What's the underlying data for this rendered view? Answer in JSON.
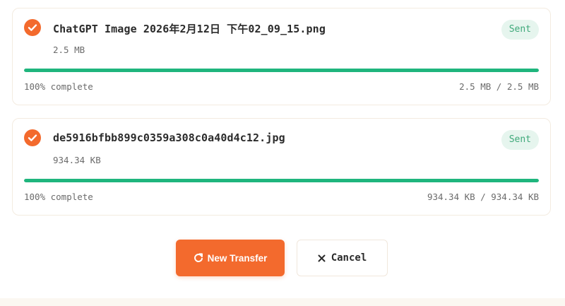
{
  "colors": {
    "accent": "#f36a2d",
    "success": "#1fb57d",
    "badge_bg": "#e6f5ee",
    "badge_text": "#3fa97a"
  },
  "transfers": [
    {
      "icon": "check-circle-icon",
      "file_name": "ChatGPT Image 2026年2月12日 下午02_09_15.png",
      "file_size": "2.5 MB",
      "status": "Sent",
      "progress_percent": 100,
      "progress_label": "100% complete",
      "progress_bytes": "2.5 MB / 2.5 MB"
    },
    {
      "icon": "check-circle-icon",
      "file_name": "de5916bfbb899c0359a308c0a40d4c12.jpg",
      "file_size": "934.34 KB",
      "status": "Sent",
      "progress_percent": 100,
      "progress_label": "100% complete",
      "progress_bytes": "934.34 KB / 934.34 KB"
    }
  ],
  "actions": {
    "new_transfer_label": "New Transfer",
    "new_transfer_icon": "refresh-icon",
    "cancel_label": "Cancel",
    "cancel_icon": "close-icon"
  }
}
